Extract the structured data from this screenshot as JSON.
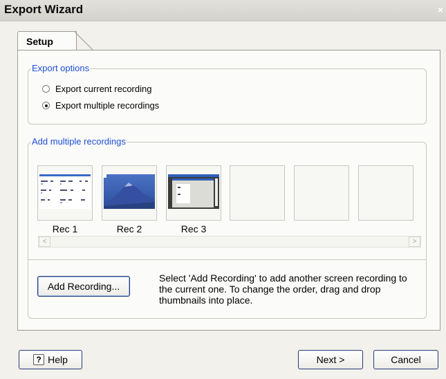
{
  "window": {
    "title": "Export Wizard",
    "close_glyph": "×"
  },
  "tab": {
    "label": "Setup"
  },
  "export_options": {
    "title": "Export options",
    "options": [
      {
        "label": "Export current recording",
        "checked": false
      },
      {
        "label": "Export multiple recordings",
        "checked": true
      }
    ]
  },
  "multi": {
    "title": "Add multiple recordings",
    "thumbnails": [
      "Rec 1",
      "Rec 2",
      "Rec 3"
    ],
    "empty_slots": 3,
    "scroll_left": "<",
    "scroll_right": ">",
    "add_button": "Add Recording...",
    "description": "Select 'Add Recording' to add another screen recording to the current one. To change the order, drag and drop thumbnails into place."
  },
  "footer": {
    "help": "Help",
    "next": "Next >",
    "cancel": "Cancel"
  },
  "icons": {
    "help": "help-icon",
    "close": "close-icon"
  }
}
